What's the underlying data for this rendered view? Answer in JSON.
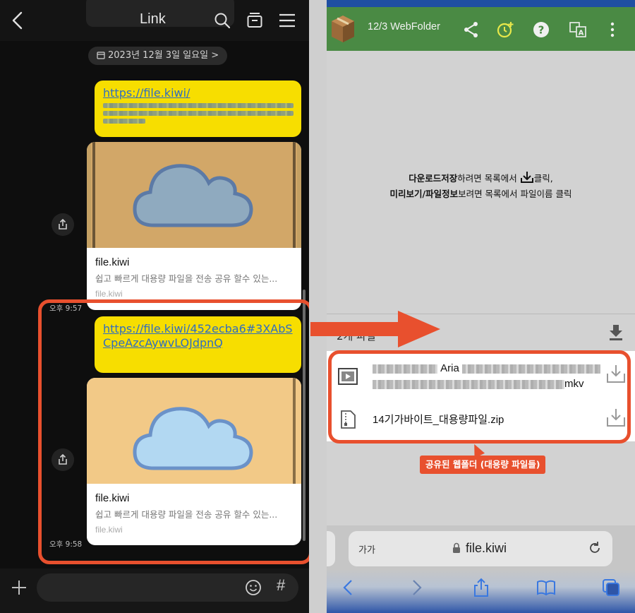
{
  "chat": {
    "title": "Link",
    "date_chip": "2023년 12월 3일 일요일",
    "messages": [
      {
        "link_text": "https://file.kiwi/",
        "card_title": "file.kiwi",
        "card_desc": "쉽고 빠르게 대용량 파일을 전송 공유 할수 있는...",
        "card_domain": "file.kiwi",
        "time": "오후 9:57"
      },
      {
        "link_text": "https://file.kiwi/452ecba6#3XAbSCpeAzcAywvLOJdpnQ",
        "card_title": "file.kiwi",
        "card_desc": "쉽고 빠르게 대용량 파일을 전송 공유 할수 있는...",
        "card_domain": "file.kiwi",
        "time": "오후 9:58"
      }
    ],
    "hash_label": "#"
  },
  "webfolder": {
    "app_title": "12/3 WebFolder",
    "instruction_line1_bold": "다운로드저장",
    "instruction_line1_rest": "하려면 목록에서",
    "instruction_line1_end": "클릭,",
    "instruction_line2_bold": "미리보기/파일정보",
    "instruction_line2_rest": "보려면 목록에서 파일이름 클릭",
    "file_count": "2개 파일",
    "files": [
      {
        "name_part1": "Aria",
        "name_part2": "mkv",
        "type": "video"
      },
      {
        "name": "14기가바이트_대용량파일.zip",
        "type": "zip"
      }
    ],
    "callout": "공유된 웹폴더 (대용량 파일들)"
  },
  "browser": {
    "text_size_label": "가가",
    "url": "file.kiwi"
  },
  "colors": {
    "accent_red": "#e8502e",
    "kakao_yellow": "#f7de00",
    "appbar_green": "#4a8a44"
  }
}
